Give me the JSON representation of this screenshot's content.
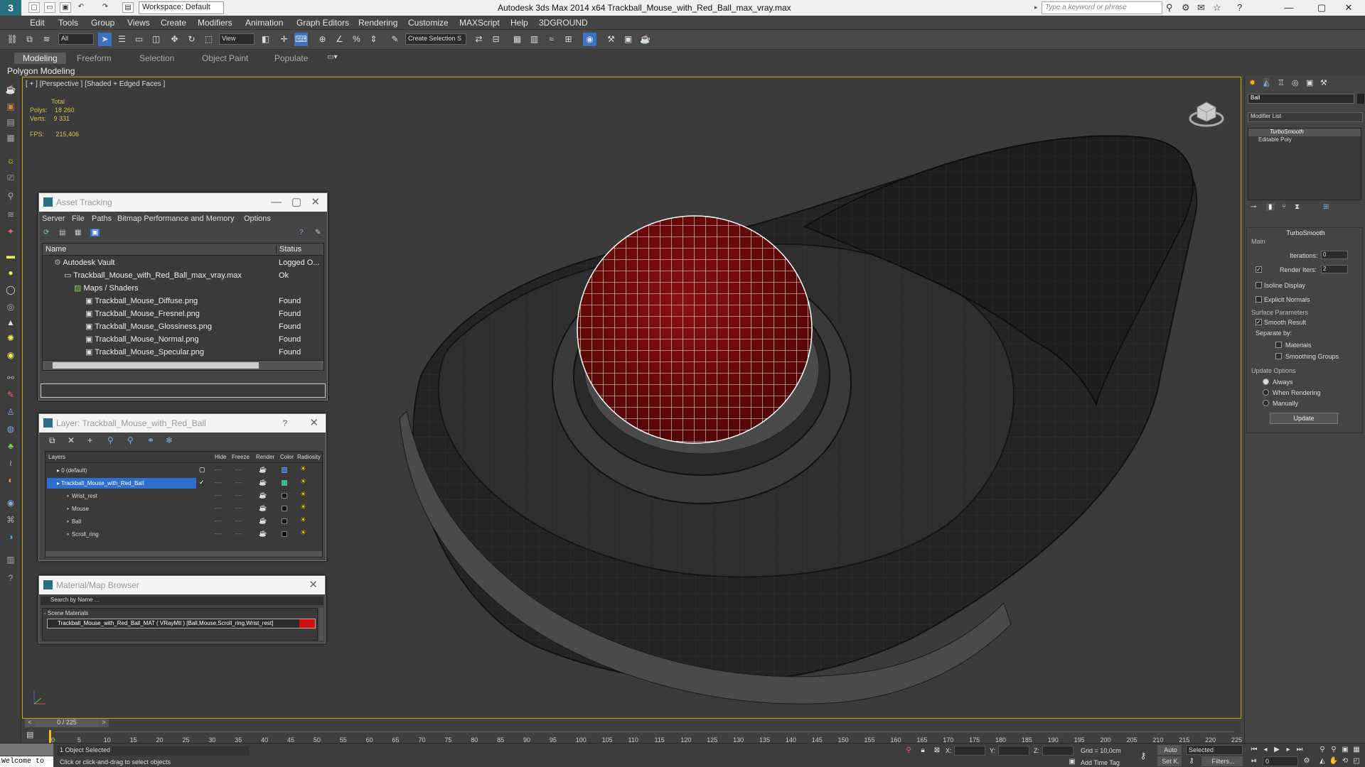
{
  "app": {
    "title": "Autodesk 3ds Max  2014 x64     Trackball_Mouse_with_Red_Ball_max_vray.max",
    "logo_glyph": "3",
    "workspace": "Workspace: Default",
    "search_placeholder": "Type a keyword or phrase"
  },
  "menu": [
    "Edit",
    "Tools",
    "Group",
    "Views",
    "Create",
    "Modifiers",
    "Animation",
    "Graph Editors",
    "Rendering",
    "Customize",
    "MAXScript",
    "Help",
    "3DGROUND"
  ],
  "toolbar": {
    "selection_filter": "All",
    "reference_coord": "View",
    "named_selection": "Create Selection S"
  },
  "ribbon": {
    "tabs": [
      "Modeling",
      "Freeform",
      "Selection",
      "Object Paint",
      "Populate"
    ],
    "active_tab": "Modeling",
    "panel_label": "Polygon Modeling"
  },
  "viewport": {
    "label": "[ + ] [Perspective ] [Shaded + Edged Faces ]",
    "stats": {
      "total": "Total",
      "polys_label": "Polys:",
      "polys": "18 260",
      "verts_label": "Verts:",
      "verts": "9 331",
      "fps_label": "FPS:",
      "fps": "215,406"
    },
    "ball_color": "#7a0a0a",
    "body_color": "#2a2a2a",
    "wire_color": "#ffffff"
  },
  "asset_tracking": {
    "title": "Asset Tracking",
    "menu": [
      "Server",
      "File",
      "Paths",
      "Bitmap Performance and Memory",
      "Options"
    ],
    "col_name": "Name",
    "col_status": "Status",
    "rows": [
      {
        "name": "Autodesk Vault",
        "status": "Logged O..."
      },
      {
        "name": "Trackball_Mouse_with_Red_Ball_max_vray.max",
        "status": "Ok"
      },
      {
        "name": "Maps / Shaders",
        "status": ""
      },
      {
        "name": "Trackball_Mouse_Diffuse.png",
        "status": "Found"
      },
      {
        "name": "Trackball_Mouse_Fresnel.png",
        "status": "Found"
      },
      {
        "name": "Trackball_Mouse_Glossiness.png",
        "status": "Found"
      },
      {
        "name": "Trackball_Mouse_Normal.png",
        "status": "Found"
      },
      {
        "name": "Trackball_Mouse_Specular.png",
        "status": "Found"
      }
    ]
  },
  "layer_panel": {
    "title": "Layer: Trackball_Mouse_with_Red_Ball",
    "help": "?",
    "cols": [
      "Layers",
      "Hide",
      "Freeze",
      "Render",
      "Color",
      "Radiosity"
    ],
    "rows": [
      {
        "name": "0 (default)",
        "color": "#3a6fd8"
      },
      {
        "name": "Trackball_Mouse_with_Red_Ball",
        "color": "#17c9a0"
      },
      {
        "name": "Wrist_rest",
        "color": "#111111"
      },
      {
        "name": "Mouse",
        "color": "#111111"
      },
      {
        "name": "Ball",
        "color": "#111111"
      },
      {
        "name": "Scroll_ring",
        "color": "#111111"
      }
    ],
    "dash": "----"
  },
  "material_browser": {
    "title": "Material/Map Browser",
    "search": "Search by Name ...",
    "group": "- Scene Materials",
    "material": "Trackball_Mouse_with_Red_Ball_MAT  ( VRayMtl )  [Ball,Mouse,Scroll_ring,Wrist_rest]",
    "swatch_color": "#d01010"
  },
  "command_panel": {
    "object_name": "Ball",
    "modifier_list": "Modifier List",
    "stack": [
      "TurboSmooth",
      "Editable Poly"
    ],
    "rollout_title": "TurboSmooth",
    "main": "Main",
    "iterations_label": "Iterations:",
    "iterations": "0",
    "render_iters_label": "Render Iters:",
    "render_iters": "2",
    "isoline": "Isoline Display",
    "explicit_normals": "Explicit Normals",
    "surface_params": "Surface Parameters",
    "smooth_result": "Smooth Result",
    "separate_by": "Separate by:",
    "materials": "Materials",
    "smoothing_groups": "Smoothing Groups",
    "update_options": "Update Options",
    "always": "Always",
    "when_rendering": "When Rendering",
    "manually": "Manually",
    "update": "Update"
  },
  "timeline": {
    "frame": "0 / 225",
    "ticks": [
      "0",
      "5",
      "10",
      "15",
      "20",
      "25",
      "30",
      "35",
      "40",
      "45",
      "50",
      "55",
      "60",
      "65",
      "70",
      "75",
      "80",
      "85",
      "90",
      "95",
      "100",
      "105",
      "110",
      "115",
      "120",
      "125",
      "130",
      "135",
      "140",
      "145",
      "150",
      "155",
      "160",
      "165",
      "170",
      "175",
      "180",
      "185",
      "190",
      "195",
      "200",
      "205",
      "210",
      "215",
      "220",
      "225"
    ]
  },
  "status": {
    "listener": "Welcome to",
    "selected": "1 Object Selected",
    "prompt": "Click or click-and-drag to select objects",
    "x_label": "X:",
    "y_label": "Y:",
    "z_label": "Z:",
    "grid": "Grid = 10,0cm",
    "add_time_tag": "Add Time Tag",
    "auto": "Auto",
    "set_key": "Set K.",
    "selected_dd": "Selected",
    "filters": "Filters...",
    "frame_field": "0"
  }
}
